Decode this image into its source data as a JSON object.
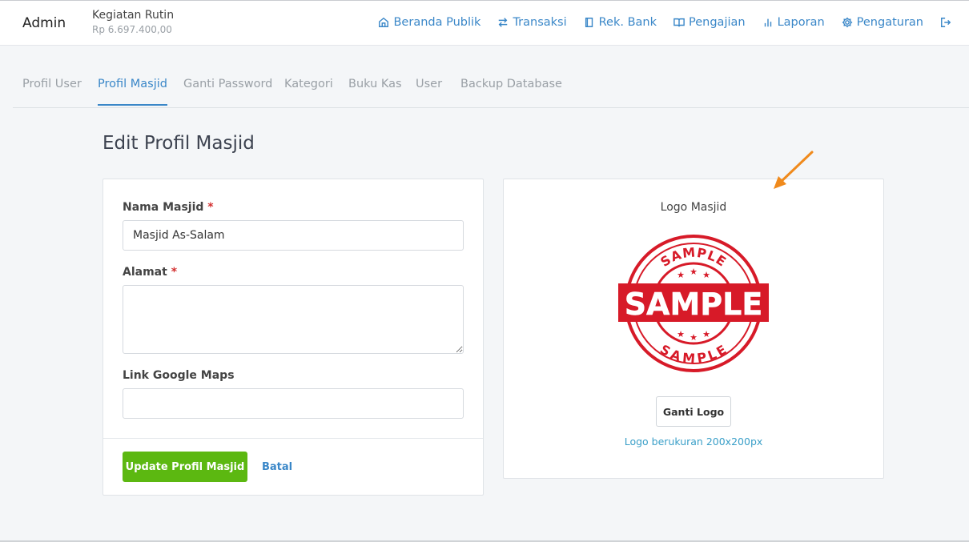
{
  "header": {
    "brand": "Admin",
    "activity_name": "Kegiatan Rutin",
    "activity_amount": "Rp 6.697.400,00",
    "nav": [
      {
        "label": "Beranda Publik",
        "icon": "home-icon"
      },
      {
        "label": "Transaksi",
        "icon": "swap-icon"
      },
      {
        "label": "Rek. Bank",
        "icon": "book-icon"
      },
      {
        "label": "Pengajian",
        "icon": "open-book-icon"
      },
      {
        "label": "Laporan",
        "icon": "bar-chart-icon"
      },
      {
        "label": "Pengaturan",
        "icon": "gear-icon"
      }
    ],
    "logout_icon": "logout-icon"
  },
  "tabs": [
    {
      "label": "Profil User",
      "active": false
    },
    {
      "label": "Profil Masjid",
      "active": true
    },
    {
      "label": "Ganti Password",
      "active": false
    },
    {
      "label": "Kategori",
      "active": false
    },
    {
      "label": "Buku Kas",
      "active": false
    },
    {
      "label": "User",
      "active": false
    },
    {
      "label": "Backup Database",
      "active": false
    }
  ],
  "page": {
    "title": "Edit Profil Masjid"
  },
  "form": {
    "name_label": "Nama Masjid",
    "name_value": "Masjid As-Salam",
    "address_label": "Alamat",
    "address_value": "",
    "maps_label": "Link Google Maps",
    "maps_value": "",
    "required_mark": "*",
    "update_button": "Update Profil Masjid",
    "cancel_link": "Batal"
  },
  "logo": {
    "label": "Logo Masjid",
    "stamp_text": "SAMPLE",
    "change_button": "Ganti Logo",
    "hint": "Logo berukuran 200x200px"
  },
  "colors": {
    "accent": "#3a87c8",
    "primary_button": "#5cb811",
    "required": "#d32f2f",
    "stamp_red": "#d71a28",
    "annotation_arrow": "#f08a1c"
  }
}
